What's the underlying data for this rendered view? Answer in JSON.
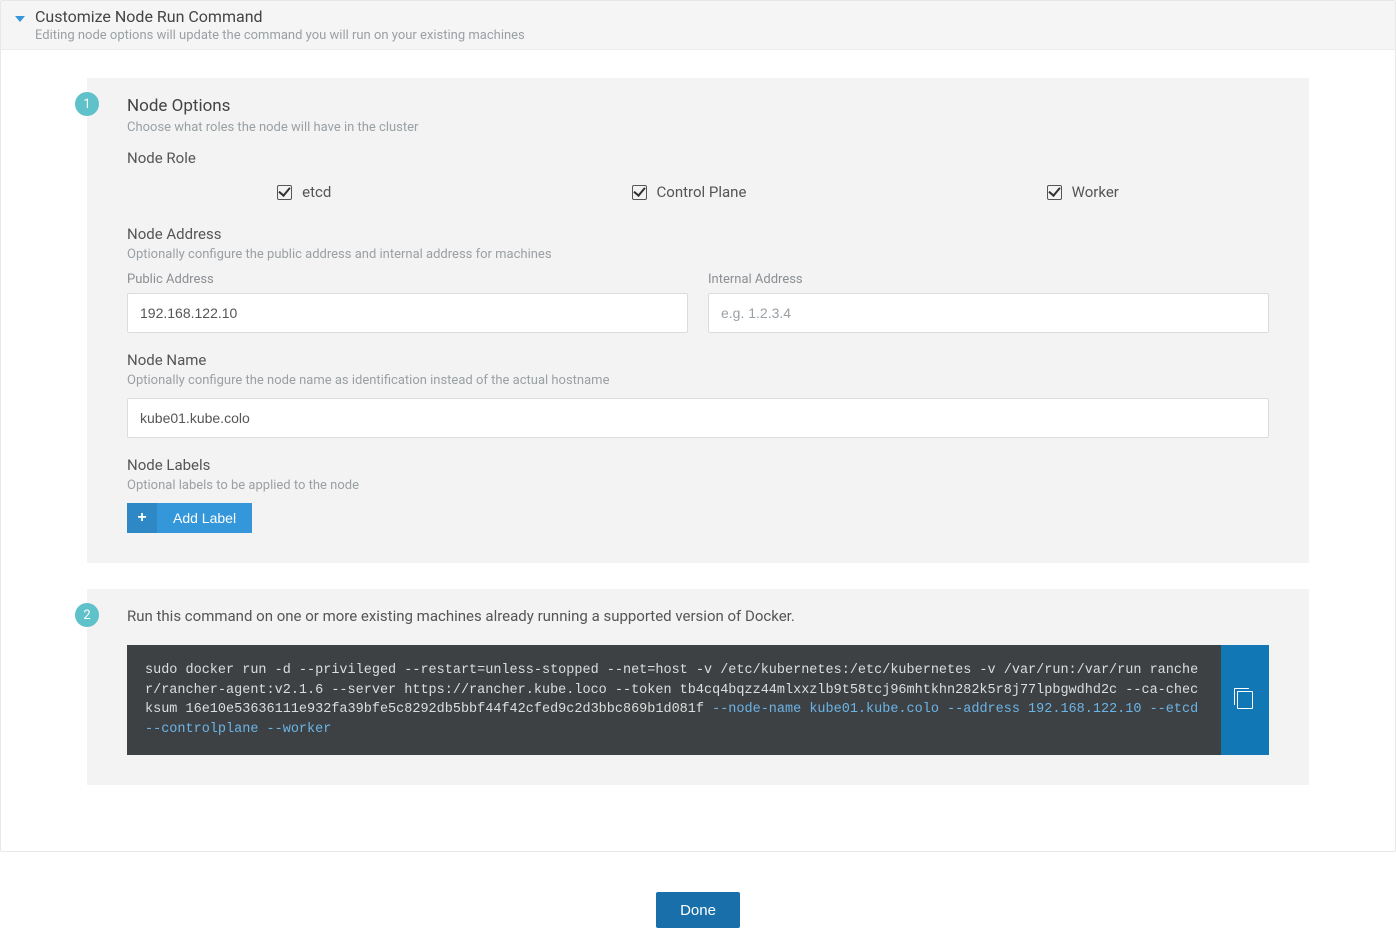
{
  "header": {
    "title": "Customize Node Run Command",
    "subtitle": "Editing node options will update the command you will run on your existing machines"
  },
  "step1": {
    "badge": "1",
    "title": "Node Options",
    "subtitle": "Choose what roles the node will have in the cluster",
    "role_label": "Node Role",
    "roles": {
      "etcd": "etcd",
      "control": "Control Plane",
      "worker": "Worker"
    },
    "address_title": "Node Address",
    "address_sub": "Optionally configure the public address and internal address for machines",
    "public_label": "Public Address",
    "public_value": "192.168.122.10",
    "internal_label": "Internal Address",
    "internal_placeholder": "e.g. 1.2.3.4",
    "name_title": "Node Name",
    "name_sub": "Optionally configure the node name as identification instead of the actual hostname",
    "name_value": "kube01.kube.colo",
    "labels_title": "Node Labels",
    "labels_sub": "Optional labels to be applied to the node",
    "add_label": "Add Label"
  },
  "step2": {
    "badge": "2",
    "run_text": "Run this command on one or more existing machines already running a supported version of Docker.",
    "cmd_pre": "sudo docker run -d --privileged --restart=unless-stopped --net=host -v /etc/kubernetes:/etc/kubernetes -v /var/run:/var/run rancher/rancher-agent:v2.1.6 --server https://rancher.kube.loco --token tb4cq4bqzz44mlxxzlb9t58tcj96mhtkhn282k5r8j77lpbgwdhd2c --ca-checksum 16e10e53636111e932fa39bfe5c8292db5bbf44f42cfed9c2d3bbc869b1d081f",
    "cmd_hl": " --node-name kube01.kube.colo --address 192.168.122.10 --etcd --controlplane --worker"
  },
  "footer": {
    "done": "Done"
  }
}
